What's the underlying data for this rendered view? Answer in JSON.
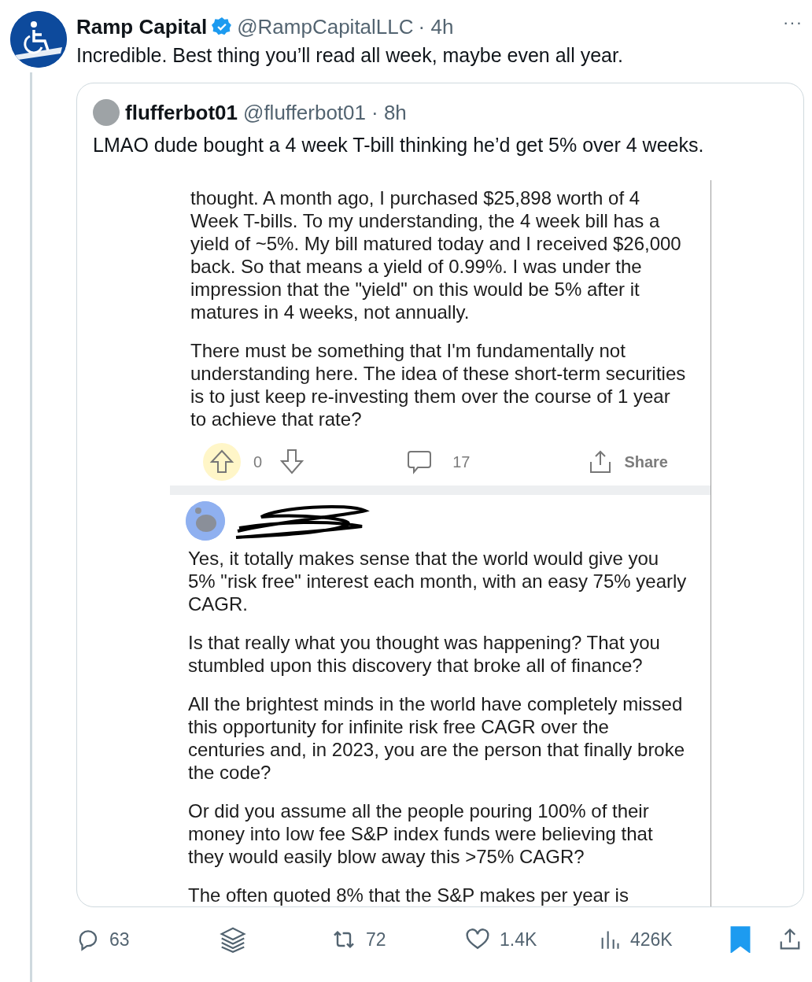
{
  "tweet": {
    "author": {
      "name": "Ramp Capital",
      "handle": "@RampCapitalLLC",
      "time": "· 4h",
      "verified": true
    },
    "text": "Incredible. Best thing you’ll read all week, maybe even all year.",
    "more": "···",
    "quote": {
      "author": {
        "name": "flufferbot01",
        "handle": "@flufferbot01",
        "time": "· 8h"
      },
      "text": "LMAO dude bought a 4 week T-bill thinking he’d get 5% over 4 weeks.",
      "screenshot": {
        "post_paragraphs": [
          "thought. A month ago, I purchased $25,898 worth of 4 Week T-bills. To my understanding, the 4 week bill has a yield of ~5%. My bill matured today and I received $26,000 back. So that means a yield of 0.99%. I was under the impression that the \"yield\" on this would be 5% after it matures in 4 weeks, not annually.",
          "There must be something that I'm fundamentally not understanding here. The idea of these short-term securities is to just keep re-investing them over the course of 1 year to achieve that rate?"
        ],
        "votes": "0",
        "comments": "17",
        "share": "Share",
        "comment_paragraphs": [
          "Yes, it totally makes sense that the world would give you 5% \"risk free\" interest each month, with an easy 75% yearly CAGR.",
          "Is that really what you thought was happening?  That you stumbled upon this discovery that broke all of finance?",
          "All the brightest minds in the world have completely missed this opportunity for infinite risk free CAGR over the centuries and, in 2023, you are the person that finally broke the code?",
          "Or did you assume all the people pouring 100% of their money into low fee S&P index funds were believing that they would easily blow away this >75% CAGR?",
          "The often quoted 8% that the S&P makes per year is"
        ]
      }
    },
    "actions": {
      "replies": "63",
      "retweets": "72",
      "likes": "1.4K",
      "views": "426K",
      "bookmarked": true
    }
  }
}
